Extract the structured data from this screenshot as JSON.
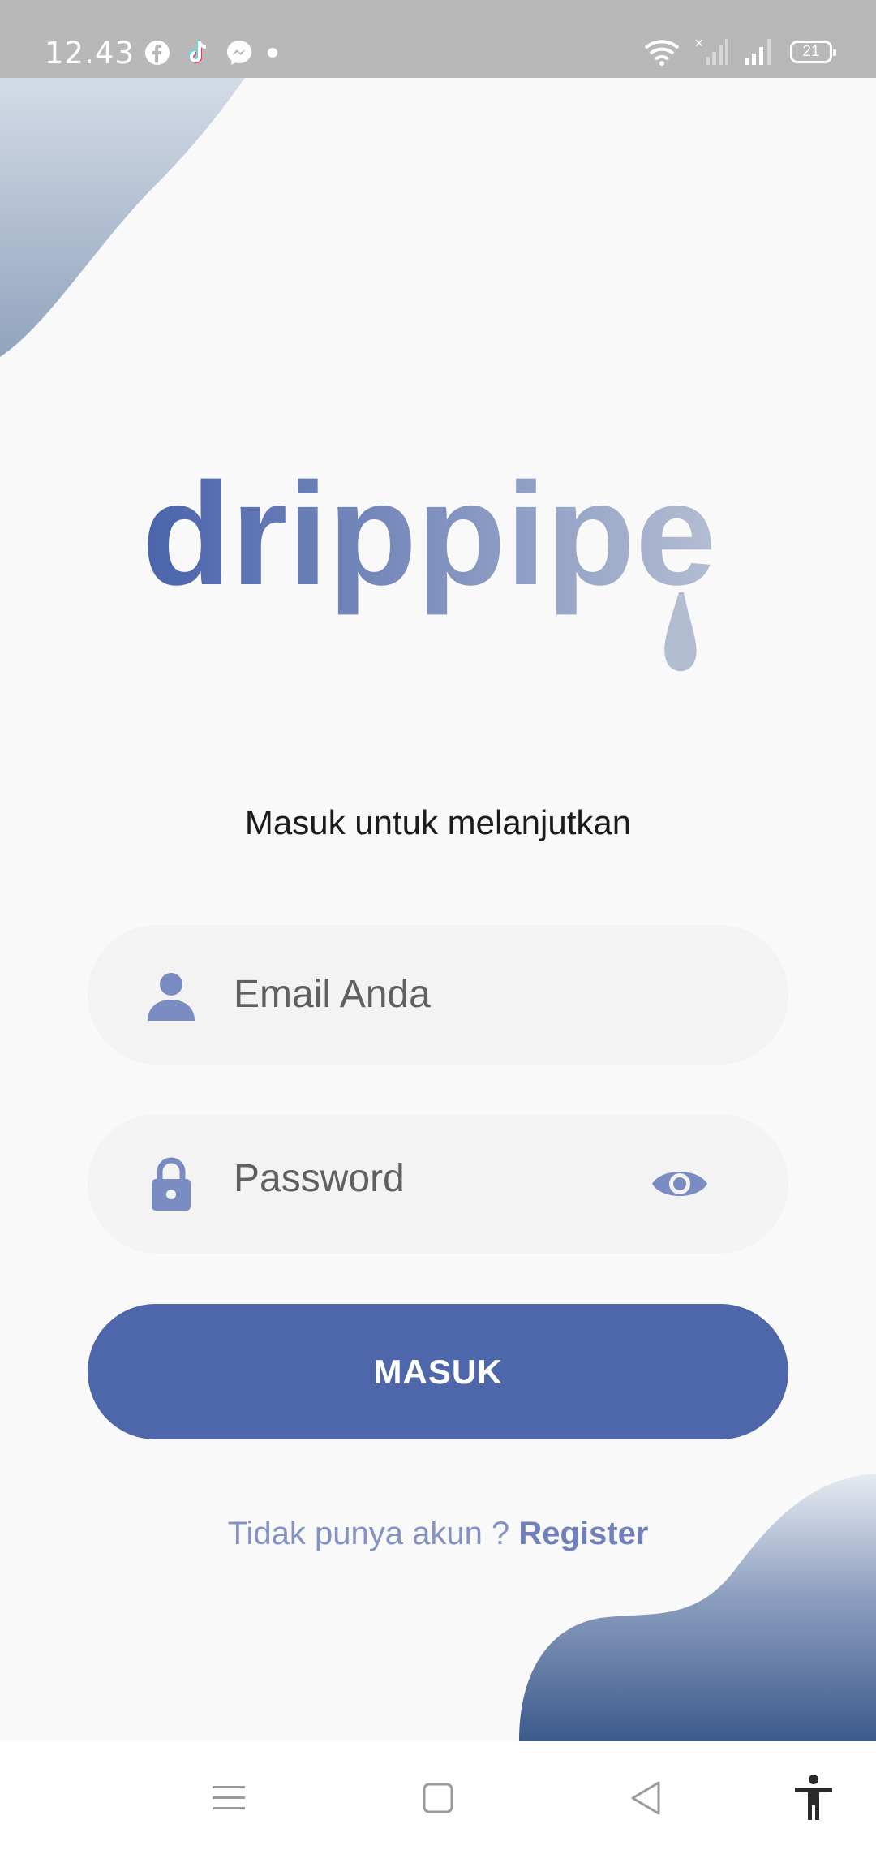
{
  "status_bar": {
    "time": "12.43",
    "battery": "21",
    "left_icons": [
      "facebook-icon",
      "tiktok-icon",
      "messenger-icon",
      "dot-icon"
    ],
    "right_icons": [
      "wifi-icon",
      "signal-no-sim-icon",
      "signal-icon",
      "battery-icon"
    ]
  },
  "logo": {
    "text": "drippipe"
  },
  "subtitle": "Masuk untuk melanjutkan",
  "email_field": {
    "placeholder": "Email Anda",
    "icon": "person-icon"
  },
  "password_field": {
    "placeholder": "Password",
    "icon": "lock-icon",
    "toggle_icon": "eye-icon"
  },
  "login_button": {
    "label": "MASUK"
  },
  "register": {
    "prompt": "Tidak punya akun ?",
    "link": "Register"
  },
  "nav_bar": {
    "items": [
      "menu-icon",
      "home-icon",
      "back-icon",
      "accessibility-icon"
    ]
  },
  "colors": {
    "primary": "#4e67aa",
    "accent_light": "#8391c4",
    "background": "#f9f9f9",
    "field_bg": "#f3f3f3",
    "status_bar": "#b8b8b8"
  }
}
